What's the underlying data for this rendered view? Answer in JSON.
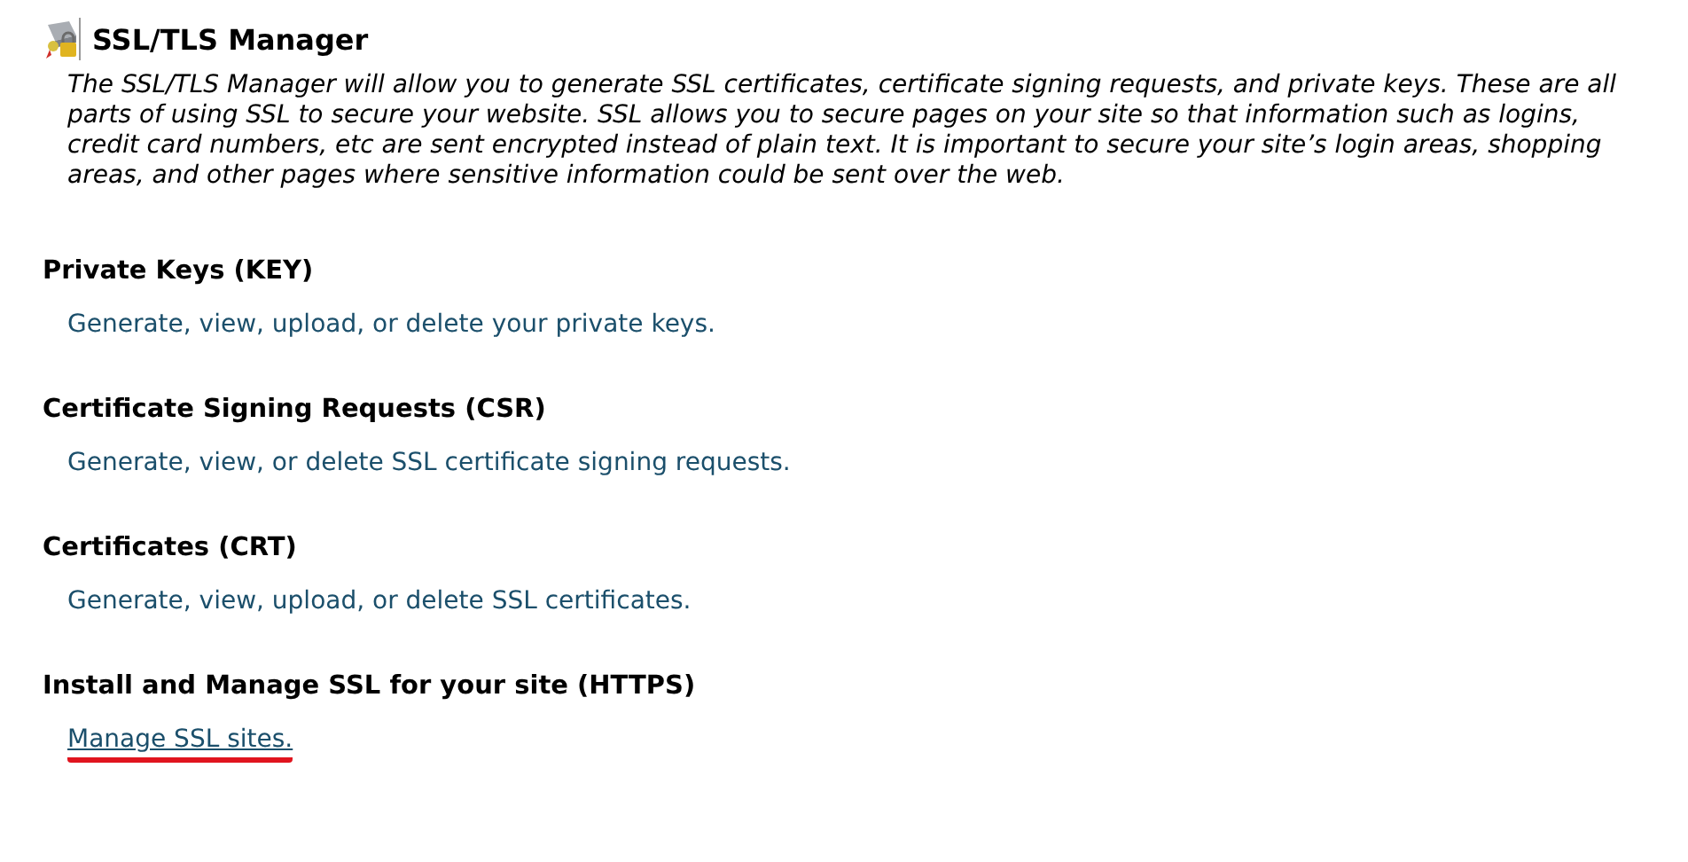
{
  "header": {
    "title": "SSL/TLS Manager"
  },
  "intro": "The SSL/TLS Manager will allow you to generate SSL certificates, certificate signing requests, and private keys. These are all parts of using SSL to secure your website. SSL allows you to secure pages on your site so that information such as logins, credit card numbers, etc are sent encrypted instead of plain text. It is important to secure your site’s login areas, shopping areas, and other pages where sensitive information could be sent over the web.",
  "sections": [
    {
      "heading": "Private Keys (KEY)",
      "description": "Generate, view, upload, or delete your private keys.",
      "kind": "text",
      "highlighted": false
    },
    {
      "heading": "Certificate Signing Requests (CSR)",
      "description": "Generate, view, or delete SSL certificate signing requests.",
      "kind": "text",
      "highlighted": false
    },
    {
      "heading": "Certificates (CRT)",
      "description": "Generate, view, upload, or delete SSL certificates.",
      "kind": "text",
      "highlighted": false
    },
    {
      "heading": "Install and Manage SSL for your site (HTTPS)",
      "description": "Manage SSL sites.",
      "kind": "link",
      "highlighted": true
    }
  ]
}
